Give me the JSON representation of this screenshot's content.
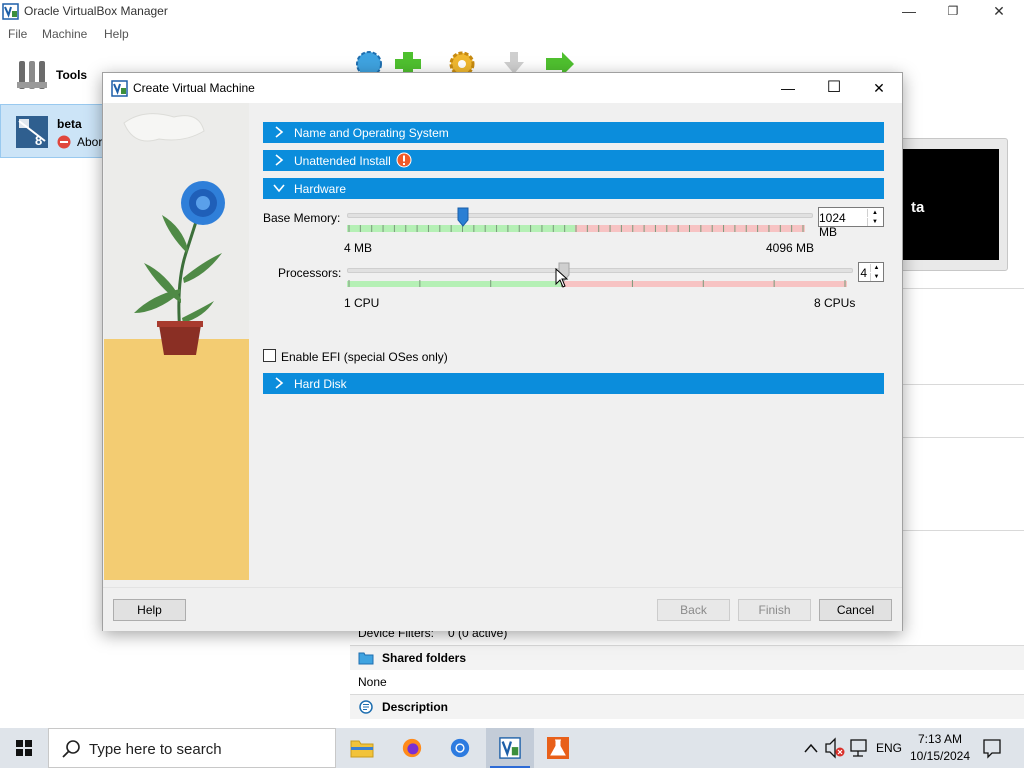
{
  "main_window": {
    "title": "Oracle VirtualBox Manager",
    "controls": {
      "minimize": "—",
      "restore": "❐",
      "close": "✕"
    }
  },
  "menu": [
    "File",
    "Machine",
    "Help"
  ],
  "left_panel": {
    "tools_label": "Tools",
    "vm": {
      "name": "beta",
      "state": "Abor",
      "os_badge": "8"
    }
  },
  "right_panel": {
    "preview_text": "ta",
    "device_filters_label": "Device Filters:",
    "device_filters_value": "0 (0 active)",
    "shared_folders": {
      "title": "Shared folders",
      "value": "None"
    },
    "description": {
      "title": "Description"
    }
  },
  "dialog": {
    "title": "Create Virtual Machine",
    "controls": {
      "minimize": "—",
      "maximize": "☐",
      "close": "✕"
    },
    "sections": {
      "name_os": "Name and Operating System",
      "unattended": "Unattended Install",
      "hardware": "Hardware",
      "hard_disk": "Hard Disk"
    },
    "memory": {
      "label": "Base Memory:",
      "value": "1024 MB",
      "min": "4 MB",
      "max": "4096 MB",
      "fraction": 0.25
    },
    "processors": {
      "label": "Processors:",
      "value": "4",
      "min": "1 CPU",
      "max": "8 CPUs",
      "fraction": 0.43
    },
    "efi": {
      "label": "Enable EFI (special OSes only)",
      "checked": false
    },
    "buttons": {
      "help": "Help",
      "back": "Back",
      "finish": "Finish",
      "cancel": "Cancel"
    }
  },
  "taskbar": {
    "search_placeholder": "Type here to search",
    "language": "ENG",
    "time": "7:13 AM",
    "date": "10/15/2024"
  },
  "colors": {
    "section_blue": "#0b8ddc",
    "selection_bg": "#cce4f7",
    "scale_green": "#b5f0b5",
    "scale_red": "#f7c3c3",
    "slider_thumb": "#2a7fd4"
  }
}
